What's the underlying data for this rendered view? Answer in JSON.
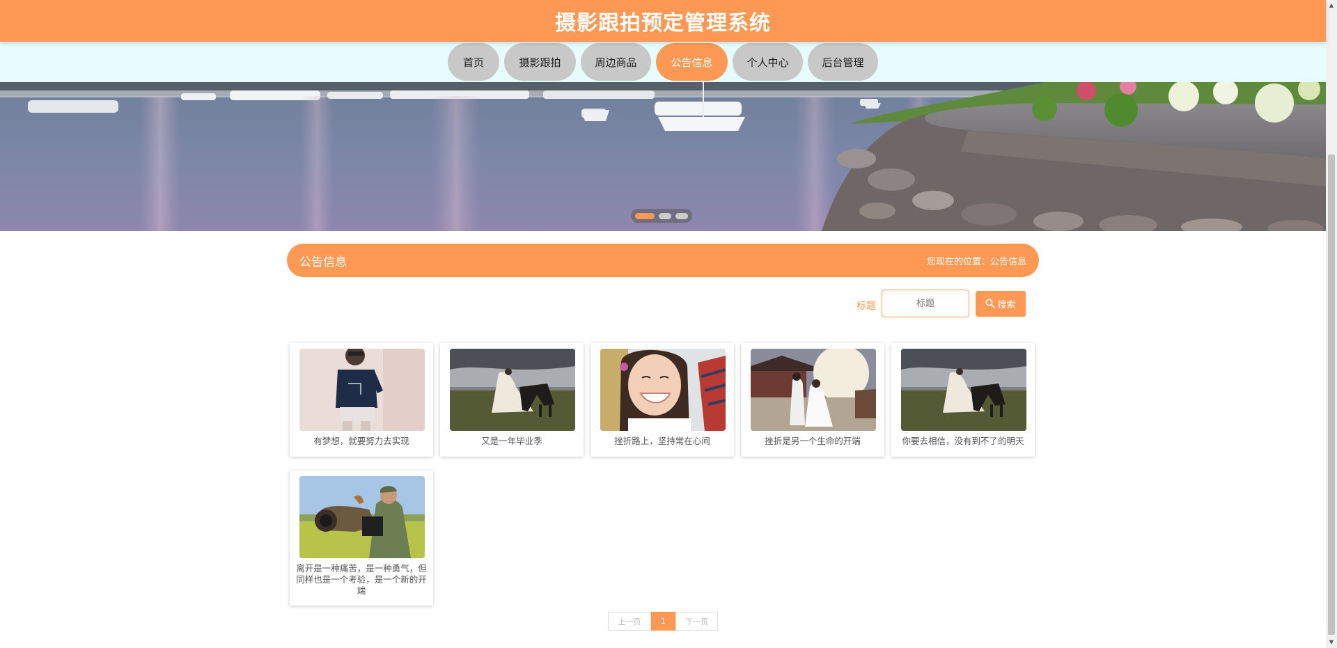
{
  "header": {
    "title": "摄影跟拍预定管理系统"
  },
  "nav": {
    "items": [
      {
        "label": "首页"
      },
      {
        "label": "摄影跟拍"
      },
      {
        "label": "周边商品"
      },
      {
        "label": "公告信息"
      },
      {
        "label": "个人中心"
      },
      {
        "label": "后台管理"
      }
    ],
    "active_index": 3
  },
  "carousel": {
    "active_index": 0,
    "slide_count": 3
  },
  "section": {
    "title": "公告信息",
    "breadcrumb": "您现在的位置：公告信息"
  },
  "search": {
    "label": "标题",
    "placeholder": "标题",
    "button_label": "搜索",
    "button_icon": "search-icon"
  },
  "cards": [
    {
      "title": "有梦想，就要努力去实现"
    },
    {
      "title": "又是一年毕业季"
    },
    {
      "title": "挫折路上，坚持常在心间"
    },
    {
      "title": "挫折是另一个生命的开端"
    },
    {
      "title": "你要去相信，没有到不了的明天"
    },
    {
      "title": "离开是一种痛苦，是一种勇气，但同样也是一个考验，是一个新的开端"
    }
  ],
  "pagination": {
    "prev_label": "上一页",
    "current_page": "1",
    "next_label": "下一页"
  },
  "colors": {
    "accent": "#fd9954",
    "nav_background": "#e7fcfd",
    "nav_inactive": "#c8c8c8"
  }
}
